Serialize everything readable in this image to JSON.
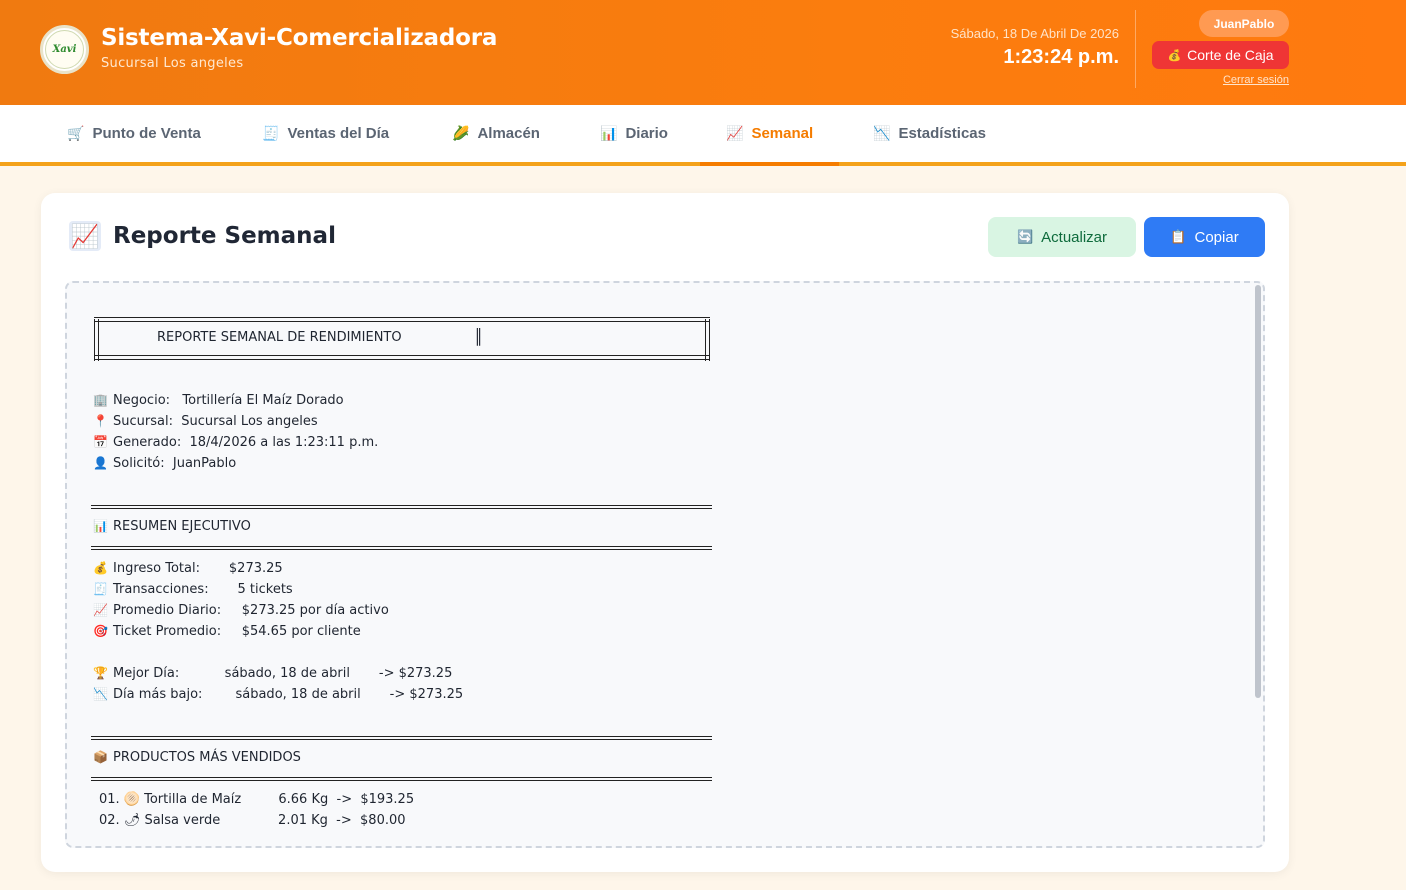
{
  "header": {
    "logo_text": "Xavi",
    "title": "Sistema-Xavi-Comercializadora",
    "subtitle": "Sucursal Los angeles",
    "date": "Sábado, 18 De Abril De 2026",
    "time": "1:23:24 p.m.",
    "user": "JuanPablo",
    "corte_icon": "💰",
    "corte_label": "Corte de Caja",
    "logout": "Cerrar sesión"
  },
  "nav": {
    "tabs": [
      {
        "icon": "🛒",
        "label": "Punto de Venta"
      },
      {
        "icon": "🧾",
        "label": "Ventas del Día"
      },
      {
        "icon": "🌽",
        "label": "Almacén"
      },
      {
        "icon": "📊",
        "label": "Diario"
      },
      {
        "icon": "📈",
        "label": "Semanal",
        "active": true
      },
      {
        "icon": "📉",
        "label": "Estadísticas"
      }
    ]
  },
  "card": {
    "icon": "📈",
    "title": "Reporte Semanal",
    "update_icon": "🔄",
    "update_label": "Actualizar",
    "copy_icon": "📋",
    "copy_label": "Copiar"
  },
  "report": {
    "banner": "REPORTE SEMANAL DE RENDIMIENTO",
    "banner_edge": "║",
    "info": [
      {
        "icon": "🏢",
        "text": "Negocio:   Tortillería El Maíz Dorado"
      },
      {
        "icon": "📍",
        "text": "Sucursal:  Sucursal Los angeles"
      },
      {
        "icon": "📅",
        "text": "Generado:  18/4/2026 a las 1:23:11 p.m."
      },
      {
        "icon": "👤",
        "text": "Solicitó:  JuanPablo"
      }
    ],
    "summary_icon": "📊",
    "summary_title": "RESUMEN EJECUTIVO",
    "summary": [
      {
        "icon": "💰",
        "text": "Ingreso Total:       $273.25"
      },
      {
        "icon": "🧾",
        "text": "Transacciones:       5 tickets"
      },
      {
        "icon": "📈",
        "text": "Promedio Diario:     $273.25 por día activo"
      },
      {
        "icon": "🎯",
        "text": "Ticket Promedio:     $54.65 por cliente"
      },
      {
        "icon": "🏆",
        "text": "Mejor Día:           sábado, 18 de abril       -> $273.25"
      },
      {
        "icon": "📉",
        "text": "Día más bajo:        sábado, 18 de abril       -> $273.25"
      }
    ],
    "products_icon": "📦",
    "products_title": "PRODUCTOS MÁS VENDIDOS",
    "products": [
      {
        "text": "01. 🫓 Tortilla de Maíz         6.66 Kg  ->  $193.25"
      },
      {
        "text": "02. 🌶 Salsa verde              2.01 Kg  ->  $80.00"
      }
    ]
  }
}
